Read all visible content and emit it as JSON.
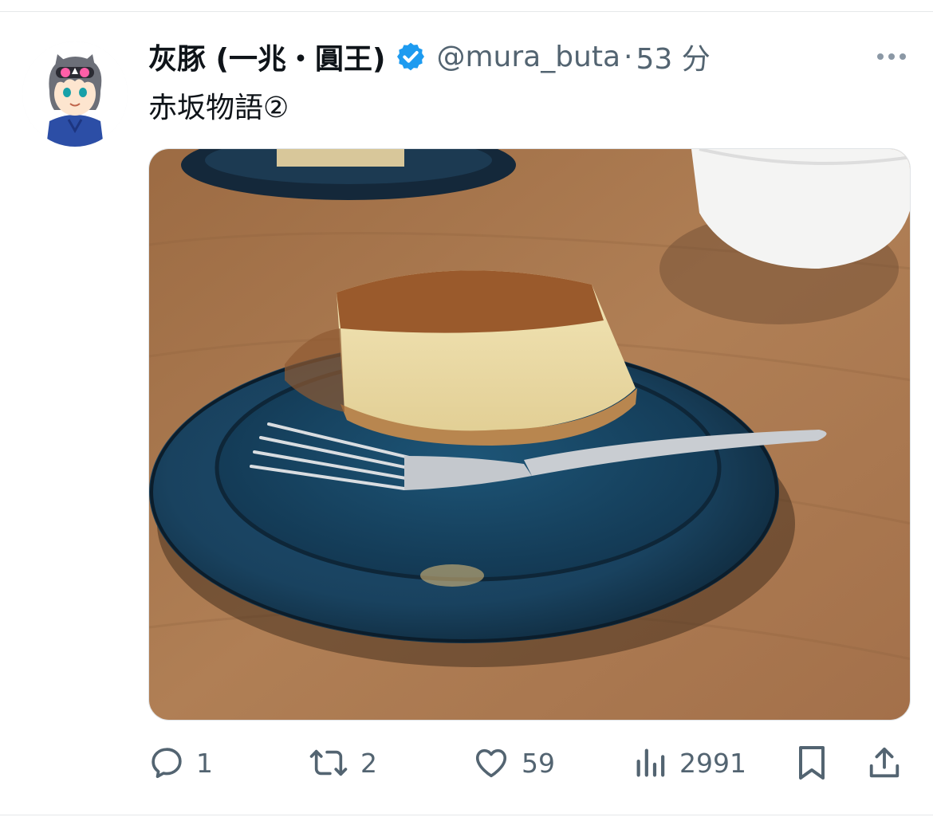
{
  "tweet": {
    "display_name": "灰豚 (一兆・圓王)",
    "handle": "@mura_buta",
    "separator": "·",
    "time": "53 分",
    "text": "赤坂物語②",
    "verified": true,
    "media_description_icon": "photo"
  },
  "actions": {
    "reply_count": "1",
    "retweet_count": "2",
    "like_count": "59",
    "views_count": "2991"
  },
  "colors": {
    "text_primary": "#0f1419",
    "text_secondary": "#536471",
    "verified_blue": "#1d9bf0",
    "divider": "#e6e8ea"
  }
}
